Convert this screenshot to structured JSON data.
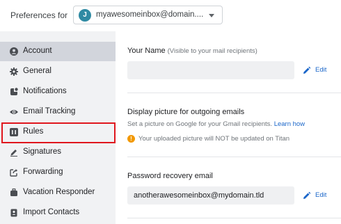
{
  "header": {
    "preferences_label": "Preferences for",
    "avatar_letter": "J",
    "account_email": "myawesomeinbox@domain...."
  },
  "sidebar": {
    "items": [
      {
        "label": "Account",
        "icon": "user-circle-icon",
        "active": true
      },
      {
        "label": "General",
        "icon": "gear-icon",
        "active": false
      },
      {
        "label": "Notifications",
        "icon": "notification-icon",
        "active": false
      },
      {
        "label": "Email Tracking",
        "icon": "eye-icon",
        "active": false
      },
      {
        "label": "Rules",
        "icon": "rules-icon",
        "active": false,
        "highlighted": true
      },
      {
        "label": "Signatures",
        "icon": "signature-pen-icon",
        "active": false
      },
      {
        "label": "Forwarding",
        "icon": "forward-icon",
        "active": false
      },
      {
        "label": "Vacation Responder",
        "icon": "suitcase-icon",
        "active": false
      },
      {
        "label": "Import Contacts",
        "icon": "contact-import-icon",
        "active": false
      }
    ]
  },
  "main": {
    "your_name": {
      "title": "Your Name",
      "hint": "(Visible to your mail recipients)",
      "value": "",
      "edit_label": "Edit"
    },
    "display_picture": {
      "title": "Display picture for outgoing emails",
      "description": "Set a picture on Google for your Gmail recipients.",
      "learn_more": "Learn how",
      "warning": "Your uploaded picture will NOT be updated on Titan"
    },
    "recovery_email": {
      "title": "Password recovery email",
      "value": "anotherawesomeinbox@mydomain.tld",
      "edit_label": "Edit"
    }
  },
  "colors": {
    "accent_link": "#1a66c9",
    "highlight_border": "#e0161d",
    "warning": "#f29900",
    "sidebar_bg": "#f1f2f4",
    "sidebar_active": "#d2d5dc"
  }
}
